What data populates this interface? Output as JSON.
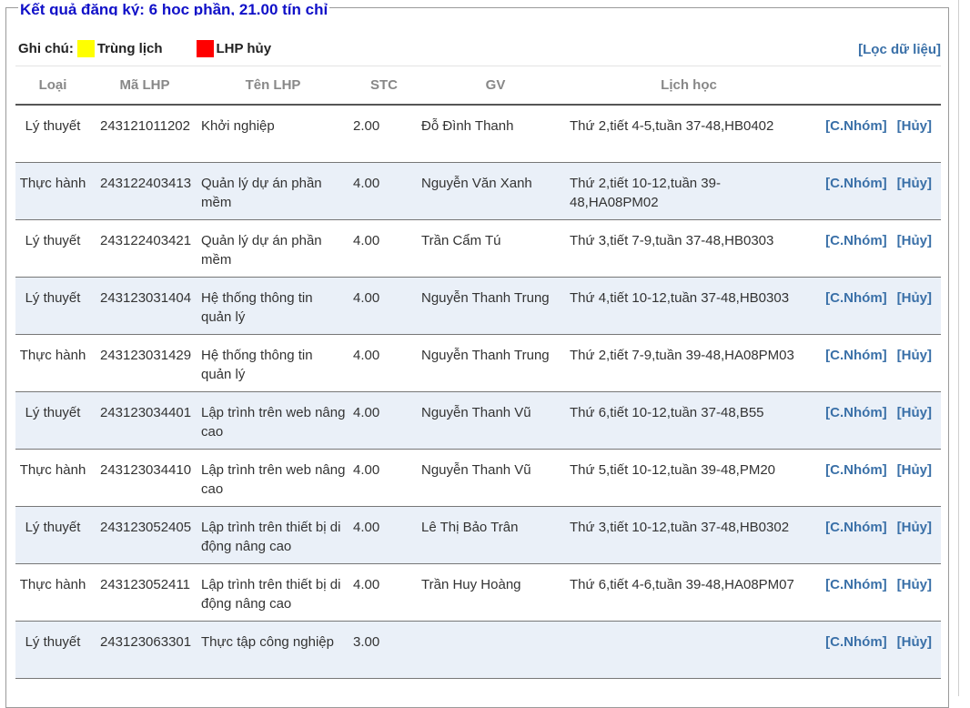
{
  "result_title": "Kết quả đăng ký: 6 học phần, 21.00 tín chỉ",
  "notes": {
    "label": "Ghi chú:",
    "items": [
      {
        "label": "Trùng lịch",
        "color": "#ffff00"
      },
      {
        "label": "LHP hủy",
        "color": "#ff0000"
      }
    ]
  },
  "filter_link": "[Lọc dữ liệu]",
  "colors": {
    "alt_row": "#eaf0f8",
    "link": "#3a70a8",
    "title": "#1010c8"
  },
  "columns": [
    "Loại",
    "Mã LHP",
    "Tên LHP",
    "STC",
    "GV",
    "Lịch học"
  ],
  "actions": {
    "group": "[C.Nhóm]",
    "cancel": "[Hủy]"
  },
  "rows": [
    {
      "loai": "Lý thuyết",
      "ma": "243121011202",
      "ten": "Khởi nghiệp",
      "stc": "2.00",
      "gv": "Đỗ Đình Thanh",
      "lich": "Thứ 2,tiết 4-5,tuần 37-48,HB0402"
    },
    {
      "loai": "Thực hành",
      "ma": "243122403413",
      "ten": "Quản lý dự án phần mềm",
      "stc": "4.00",
      "gv": "Nguyễn Văn Xanh",
      "lich": "Thứ 2,tiết 10-12,tuần 39-48,HA08PM02"
    },
    {
      "loai": "Lý thuyết",
      "ma": "243122403421",
      "ten": "Quản lý dự án phần mềm",
      "stc": "4.00",
      "gv": "Trần Cẩm Tú",
      "lich": "Thứ 3,tiết 7-9,tuần 37-48,HB0303"
    },
    {
      "loai": "Lý thuyết",
      "ma": "243123031404",
      "ten": "Hệ thống thông tin quản lý",
      "stc": "4.00",
      "gv": "Nguyễn Thanh Trung",
      "lich": "Thứ 4,tiết 10-12,tuần 37-48,HB0303"
    },
    {
      "loai": "Thực hành",
      "ma": "243123031429",
      "ten": "Hệ thống thông tin quản lý",
      "stc": "4.00",
      "gv": "Nguyễn Thanh Trung",
      "lich": "Thứ 2,tiết 7-9,tuần 39-48,HA08PM03"
    },
    {
      "loai": "Lý thuyết",
      "ma": "243123034401",
      "ten": "Lập trình trên web nâng cao",
      "stc": "4.00",
      "gv": "Nguyễn Thanh Vũ",
      "lich": "Thứ 6,tiết 10-12,tuần 37-48,B55"
    },
    {
      "loai": "Thực hành",
      "ma": "243123034410",
      "ten": "Lập trình trên web nâng cao",
      "stc": "4.00",
      "gv": "Nguyễn Thanh Vũ",
      "lich": "Thứ 5,tiết 10-12,tuần 39-48,PM20"
    },
    {
      "loai": "Lý thuyết",
      "ma": "243123052405",
      "ten": "Lập trình trên thiết bị di động nâng cao",
      "stc": "4.00",
      "gv": "Lê Thị Bảo Trân",
      "lich": "Thứ 3,tiết 10-12,tuần 37-48,HB0302"
    },
    {
      "loai": "Thực hành",
      "ma": "243123052411",
      "ten": "Lập trình trên thiết bị di động nâng cao",
      "stc": "4.00",
      "gv": "Trần Huy Hoàng",
      "lich": "Thứ 6,tiết 4-6,tuần 39-48,HA08PM07"
    },
    {
      "loai": "Lý thuyết",
      "ma": "243123063301",
      "ten": "Thực tập công nghiệp",
      "stc": "3.00",
      "gv": "",
      "lich": ""
    }
  ]
}
